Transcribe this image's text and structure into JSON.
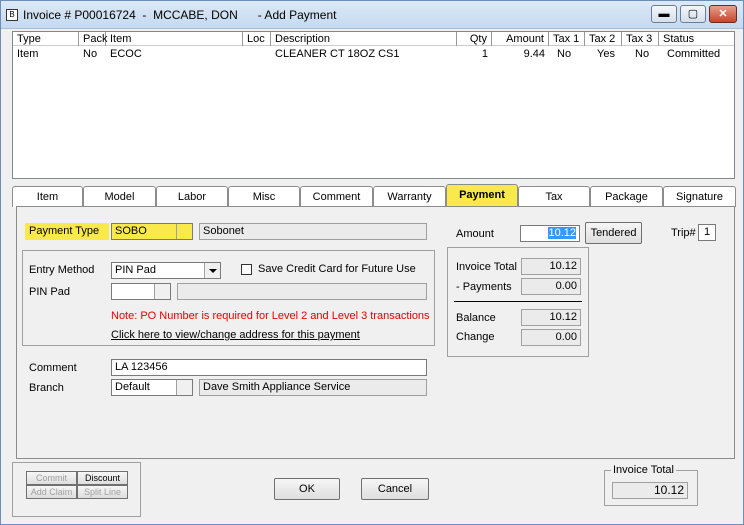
{
  "window": {
    "title": "Invoice # P00016724  -  MCCABE, DON      - Add Payment",
    "app_icon": "invoice-app-icon",
    "minimize_glyph": "▬",
    "maximize_glyph": "▢",
    "close_glyph": "✕"
  },
  "grid": {
    "columns": [
      "Type",
      "Pack",
      "Item",
      "Loc",
      "Description",
      "Qty",
      "Amount",
      "Tax 1",
      "Tax 2",
      "Tax 3",
      "Status"
    ],
    "rows": [
      {
        "type": "Item",
        "pack": "No",
        "item": "ECOC",
        "loc": "",
        "description": "CLEANER CT 18OZ CS1",
        "qty": "1",
        "amount": "9.44",
        "tax1": "No",
        "tax2": "Yes",
        "tax3": "No",
        "status": "Committed"
      }
    ]
  },
  "tabs": [
    {
      "label": "Item"
    },
    {
      "label": "Model"
    },
    {
      "label": "Labor"
    },
    {
      "label": "Misc"
    },
    {
      "label": "Comment"
    },
    {
      "label": "Warranty"
    },
    {
      "label": "Payment",
      "active": true
    },
    {
      "label": "Tax"
    },
    {
      "label": "Package"
    },
    {
      "label": "Signature"
    }
  ],
  "payment": {
    "payment_type_label": "Payment Type",
    "payment_type_code": "SOBO",
    "payment_type_name": "Sobonet",
    "entry_method_label": "Entry Method",
    "entry_method_value": "PIN Pad",
    "save_card_label": "Save Credit Card for Future Use",
    "pin_pad_label": "PIN Pad",
    "pin_pad_value": "",
    "pin_pad_detail": "",
    "note": "Note: PO Number is required for Level 2 and Level 3 transactions",
    "address_link": "Click here to view/change address for this payment",
    "comment_label": "Comment",
    "comment_value": "LA 123456",
    "branch_label": "Branch",
    "branch_code": "Default",
    "branch_name": "Dave Smith Appliance Service",
    "amount_label": "Amount",
    "amount_value": "10.12",
    "tendered_button": "Tendered",
    "trip_label": "Trip#",
    "trip_value": "1"
  },
  "totals": {
    "invoice_total_label": "Invoice Total",
    "invoice_total_value": "10.12",
    "payments_label": "- Payments",
    "payments_value": "0.00",
    "balance_label": "Balance",
    "balance_value": "10.12",
    "change_label": "Change",
    "change_value": "0.00"
  },
  "footer": {
    "commit_button": "Commit",
    "discount_button": "Discount",
    "add_claim_button": "Add Claim",
    "split_line_button": "Split Line",
    "ok_button": "OK",
    "cancel_button": "Cancel",
    "invoice_total_group_label": "Invoice Total",
    "invoice_total_value": "10.12"
  },
  "colors": {
    "highlight": "#f9e94a",
    "note_text": "#e00000"
  }
}
